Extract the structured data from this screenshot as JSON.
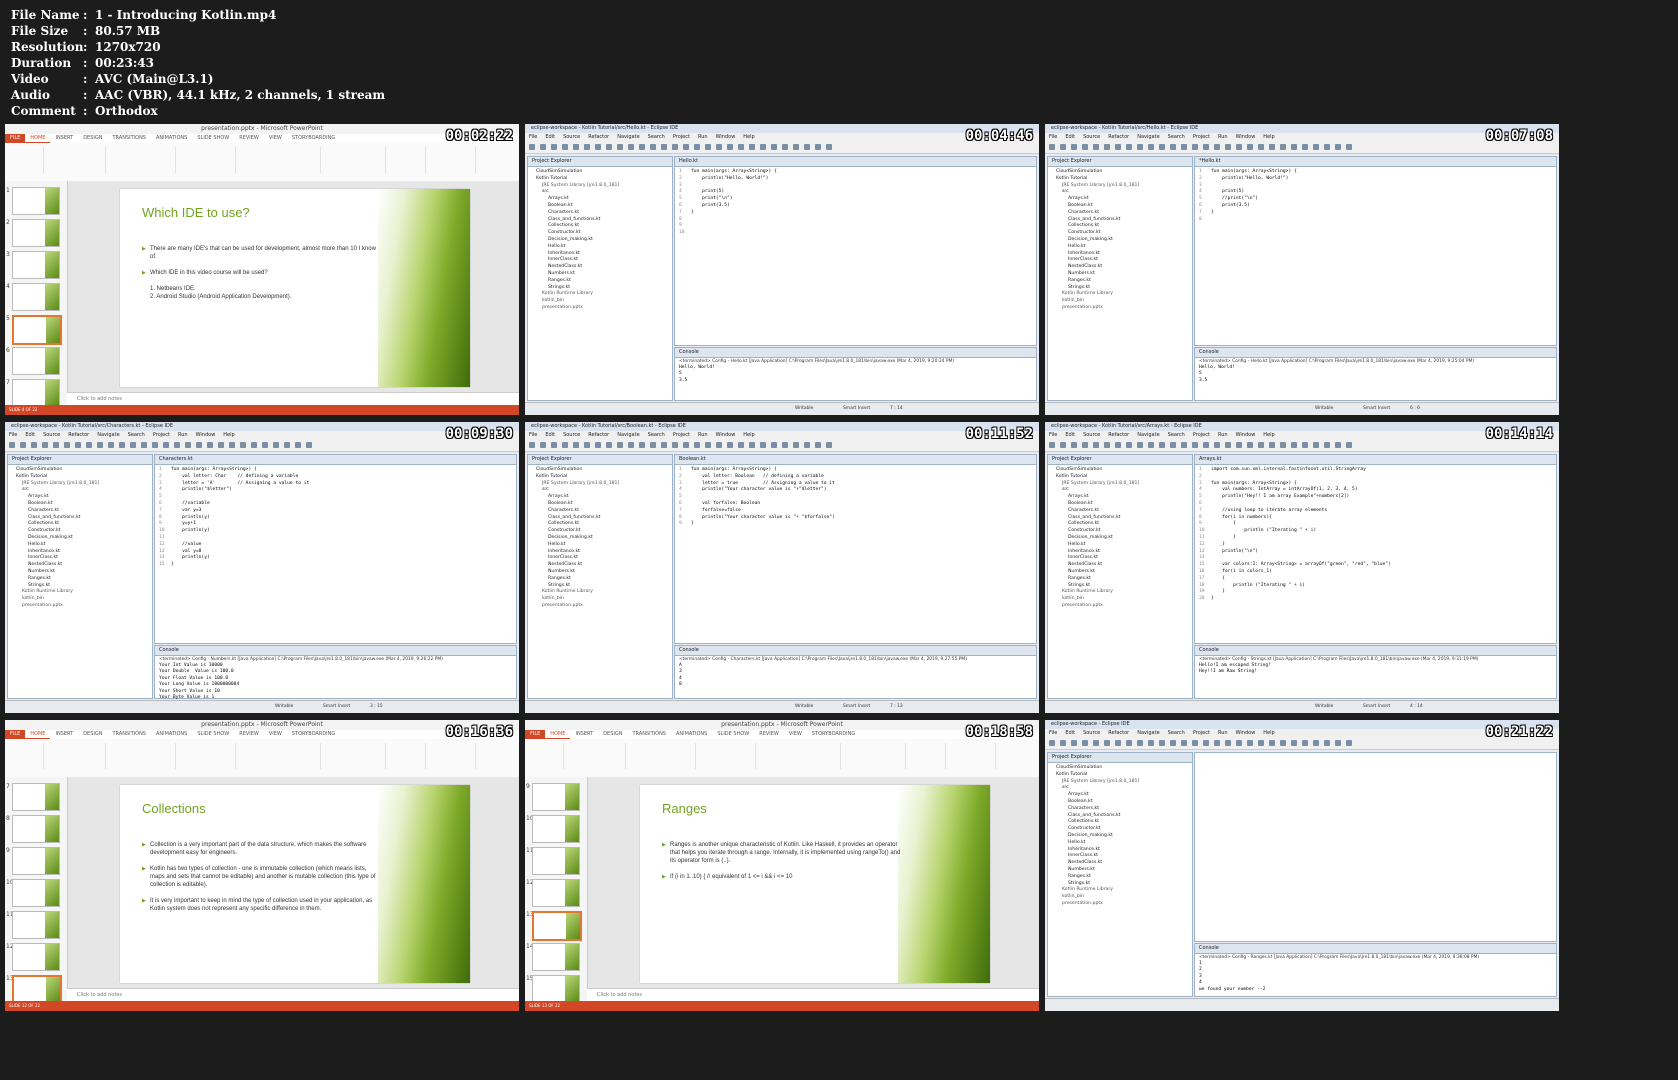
{
  "meta": {
    "rows": [
      {
        "key": "File Name",
        "value": "1 - Introducing Kotlin.mp4"
      },
      {
        "key": "File Size",
        "value": "80.57 MB"
      },
      {
        "key": "Resolution",
        "value": "1270x720"
      },
      {
        "key": "Duration",
        "value": "00:23:43"
      },
      {
        "key": "Video",
        "value": "AVC (Main@L3.1)"
      },
      {
        "key": "Audio",
        "value": "AAC (VBR), 44.1 kHz, 2 channels, 1 stream"
      },
      {
        "key": "Comment",
        "value": "Orthodox"
      }
    ],
    "separator": ":"
  },
  "ppt": {
    "window_title": "presentation.pptx - Microsoft PowerPoint",
    "tabs": [
      "FILE",
      "HOME",
      "INSERT",
      "DESIGN",
      "TRANSITIONS",
      "ANIMATIONS",
      "SLIDE SHOW",
      "REVIEW",
      "VIEW",
      "STORYBOARDING"
    ],
    "notes_placeholder": "Click to add notes",
    "accent": "#d24726",
    "slide_green": "#71a320"
  },
  "eclipse": {
    "menu": [
      "File",
      "Edit",
      "Source",
      "Refactor",
      "Navigate",
      "Search",
      "Project",
      "Run",
      "Window",
      "Help"
    ],
    "explorer_tab": "Project Explorer",
    "console_tab": "Console",
    "status_writable": "Writable",
    "status_insert": "Smart Insert",
    "tree": [
      {
        "t": "CloudSimSimulation",
        "d": 1
      },
      {
        "t": "Kotlin Tutorial",
        "d": 1
      },
      {
        "t": "JRE System Library [jre1.8.0_181]",
        "d": 2
      },
      {
        "t": "src",
        "d": 2
      },
      {
        "t": "Arrays.kt",
        "d": 3
      },
      {
        "t": "Boolean.kt",
        "d": 3
      },
      {
        "t": "Characters.kt",
        "d": 3
      },
      {
        "t": "Class_and_functions.kt",
        "d": 3
      },
      {
        "t": "Collections.kt",
        "d": 3
      },
      {
        "t": "Constructor.kt",
        "d": 3
      },
      {
        "t": "Decision_making.kt",
        "d": 3
      },
      {
        "t": "Hello.kt",
        "d": 3
      },
      {
        "t": "Inheritance.kt",
        "d": 3
      },
      {
        "t": "InnerClass.kt",
        "d": 3
      },
      {
        "t": "NestedClass.kt",
        "d": 3
      },
      {
        "t": "Numbers.kt",
        "d": 3
      },
      {
        "t": "Ranges.kt",
        "d": 3
      },
      {
        "t": "Strings.kt",
        "d": 3
      },
      {
        "t": "Kotlin Runtime Library",
        "d": 2
      },
      {
        "t": "kotlin_bin",
        "d": 2
      },
      {
        "t": "presentation.pptx",
        "d": 2
      }
    ]
  },
  "frames": [
    {
      "type": "ppt",
      "timestamp": "00:02:22",
      "selected_thumb": 4,
      "thumb_numbers": [
        "1",
        "2",
        "3",
        "4",
        "5",
        "6",
        "7"
      ],
      "slide_title": "Which IDE to use?",
      "bullets": [
        "There are many IDE's that can be used for development, almost more than 10 I know of.",
        "Which IDE in this video course will be used?"
      ],
      "numbered": [
        "1.  Netbeans IDE.",
        "2.  Android Studio (Android Application Development)."
      ],
      "status": "SLIDE 4 OF 22"
    },
    {
      "type": "eclipse",
      "timestamp": "00:04:46",
      "title": "eclipse-workspace - Kotlin Tutorial/src/Hello.kt - Eclipse IDE",
      "editor_tab": "Hello.kt",
      "code": [
        "fun main(args: Array<String>) {",
        "    println(\"Hello, World!\")",
        "",
        "    print(5)",
        "    print(\"\\n\")",
        "    print(3.5)",
        "}",
        "",
        "",
        ""
      ],
      "console_header": "<terminated> Config - Hello.kt [Java Application] C:\\Program Files\\Java\\jre1.8.0_181\\bin\\javaw.exe (Mar 4, 2019, 9:20:24 PM)",
      "console_lines": [
        "Hello, World!",
        "5",
        "3.5"
      ],
      "position": "7 : 14"
    },
    {
      "type": "eclipse",
      "timestamp": "00:07:08",
      "title": "eclipse-workspace - Kotlin Tutorial/src/Hello.kt - Eclipse IDE",
      "editor_tab": "*Hello.kt",
      "code": [
        "fun main(args: Array<String>) {",
        "    println(\"Hello, World!\")",
        "",
        "    print(5)",
        "    //print(\"\\n\")",
        "    print(3.5)",
        "}",
        ""
      ],
      "console_header": "<terminated> Config - Hello.kt [Java Application] C:\\Program Files\\Java\\jre1.8.0_181\\bin\\javaw.exe (Mar 4, 2019, 9:25:04 PM)",
      "console_lines": [
        "Hello, World!",
        "5",
        "3.5"
      ],
      "position": "6 : 6"
    },
    {
      "type": "eclipse",
      "timestamp": "00:09:30",
      "title": "eclipse-workspace - Kotlin Tutorial/src/Characters.kt - Eclipse IDE",
      "editor_tab": "Characters.kt",
      "code": [
        "fun main(args: Array<String>) {",
        "    val letter: Char    // defining a variable",
        "    letter = 'A'        // Assigning a value to it",
        "    println(\"$letter\")",
        "",
        "    //variable",
        "    var y=3",
        "    println(y)",
        "    y=y+1",
        "    println(y)",
        "",
        "    //value",
        "    val y=8",
        "    println(y)",
        "}"
      ],
      "console_header": "<terminated> Config - Numbers.kt [Java Application] C:\\Program Files\\Java\\jre1.8.0_181\\bin\\javaw.exe (Mar 4, 2019, 9:26:22 PM)",
      "console_lines": [
        "Your Int Value is 10000",
        "Your Double  Value is 100.0",
        "Your Float Value is 100.0",
        "Your Long Value is 1000000004",
        "Your Short Value is 10",
        "Your Byte Value is 1"
      ],
      "position": "3 : 15"
    },
    {
      "type": "eclipse",
      "timestamp": "00:11:52",
      "title": "eclipse-workspace - Kotlin Tutorial/src/Boolean.kt - Eclipse IDE",
      "editor_tab": "Boolean.kt",
      "code": [
        "fun main(args: Array<String>) {",
        "    val letter: Boolean   // defining a variable",
        "    letter = true         // Assigning a value to it",
        "    println(\"Your character value is \"+\"$letter\")",
        "",
        "    val forfalse: Boolean",
        "    forfalse=false",
        "    println(\"Your character value is \"+ \"$forfalse\")",
        "}"
      ],
      "console_header": "<terminated> Config - Characters.kt [Java Application] C:\\Program Files\\Java\\jre1.8.0_181\\bin\\javaw.exe (Mar 4, 2019, 9:27:55 PM)",
      "console_lines": [
        "A",
        "3",
        "4",
        "8"
      ],
      "position": "7 : 13"
    },
    {
      "type": "eclipse",
      "timestamp": "00:14:14",
      "title": "eclipse-workspace - Kotlin Tutorial/src/Arrays.kt - Eclipse IDE",
      "editor_tab": "Arrays.kt",
      "code": [
        "import com.sun.xml.internal.fastinfoset.util.StringArray",
        "",
        "fun main(args: Array<String>) {",
        "    val numbers: IntArray = intArrayOf(1, 2, 3, 4, 5)",
        "    println(\"Hey!! I am array Example\"+numbers[2])",
        "",
        "    //using loop to iterate array elements",
        "    for(i in numbers){",
        "        {",
        "            println (\"Iterating \" + i)",
        "        }",
        "    }",
        "    println(\"\\n\")",
        "",
        "    var colors:1: Array<String> = arrayOf(\"green\", \"red\", \"blue\")",
        "    for(i in colors_1)",
        "    {",
        "        println (\"Iterating \" + i)",
        "    }",
        "}"
      ],
      "console_header": "<terminated> Config - Strings.kt [Java Application] C:\\Program Files\\Java\\jre1.8.0_181\\bin\\javaw.exe (Mar 4, 2019, 9:31:19 PM)",
      "console_lines": [
        "Hello!I am escaped String!",
        "",
        "Hey!!I am Raw String!"
      ],
      "position": "4 : 14"
    },
    {
      "type": "ppt",
      "timestamp": "00:16:36",
      "selected_thumb": 6,
      "thumb_numbers": [
        "7",
        "8",
        "9",
        "10",
        "11",
        "12",
        "13"
      ],
      "slide_title": "Collections",
      "bullets": [
        "Collection is a very important part of the data structure, which makes the software development easy for engineers.",
        "Kotlin has two types of collection - one is immutable collection (which means lists, maps and sets that cannot be editable) and another is mutable collection (this type of collection is editable).",
        "It is very important to keep in mind the type of collection used in your application, as Kotlin system does not represent any specific difference in them."
      ],
      "numbered": [],
      "status": "SLIDE 12 OF 22"
    },
    {
      "type": "ppt",
      "timestamp": "00:18:58",
      "selected_thumb": 4,
      "thumb_numbers": [
        "9",
        "10",
        "11",
        "12",
        "13",
        "14",
        "15"
      ],
      "slide_title": "Ranges",
      "bullets": [
        "Ranges is another unique characteristic of Kotlin. Like Haskell, it provides an operator that helps you iterate through a range. Internally, it is implemented using rangeTo() and its operator form is (..).",
        "If (i in 1..10) { // equivalent of 1 <= i && i <= 10"
      ],
      "numbered": [],
      "status": "SLIDE 13 OF 22"
    },
    {
      "type": "eclipse",
      "timestamp": "00:21:22",
      "title": "eclipse-workspace - Eclipse IDE",
      "editor_tab": "",
      "code": [],
      "console_header": "<terminated> Config - Ranges.kt [Java Application] C:\\Program Files\\Java\\jre1.8.0_181\\bin\\javaw.exe (Mar 4, 2019, 9:38:08 PM)",
      "console_lines": [
        "",
        "1",
        "2",
        "3",
        "4",
        "",
        "",
        "we found your number --2"
      ],
      "position": ""
    }
  ]
}
